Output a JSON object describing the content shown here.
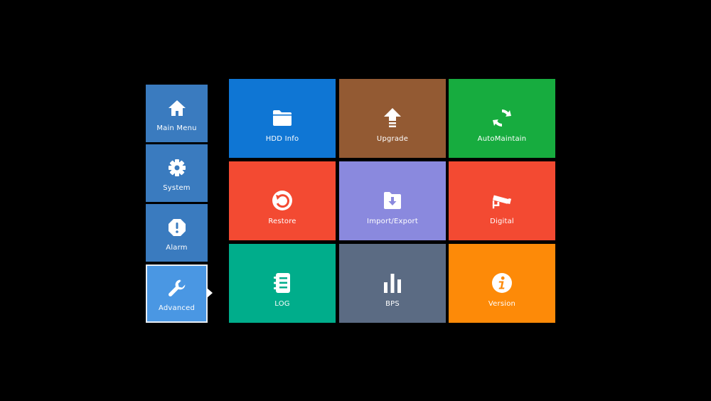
{
  "sidebar": {
    "items": [
      {
        "label": "Main Menu",
        "icon": "home-icon",
        "active": false
      },
      {
        "label": "System",
        "icon": "gear-icon",
        "active": false
      },
      {
        "label": "Alarm",
        "icon": "alert-icon",
        "active": false
      },
      {
        "label": "Advanced",
        "icon": "wrench-icon",
        "active": true
      }
    ]
  },
  "tiles": [
    {
      "label": "HDD Info",
      "icon": "folder-icon",
      "color": "#0f76d4"
    },
    {
      "label": "Upgrade",
      "icon": "upload-arrow-icon",
      "color": "#935a33"
    },
    {
      "label": "AutoMaintain",
      "icon": "refresh-icon",
      "color": "#17ac3f"
    },
    {
      "label": "Restore",
      "icon": "restore-icon",
      "color": "#f34a32"
    },
    {
      "label": "Import/Export",
      "icon": "folder-download-icon",
      "color": "#8a89de"
    },
    {
      "label": "Digital",
      "icon": "camera-icon",
      "color": "#f34a32"
    },
    {
      "label": "LOG",
      "icon": "log-book-icon",
      "color": "#00ad8b"
    },
    {
      "label": "BPS",
      "icon": "bar-chart-icon",
      "color": "#5b6b83"
    },
    {
      "label": "Version",
      "icon": "info-icon",
      "color": "#fd8a08"
    }
  ],
  "colors": {
    "background": "#000000",
    "sidebar_item": "#3a7bbf",
    "sidebar_active": "#4a97e3"
  }
}
